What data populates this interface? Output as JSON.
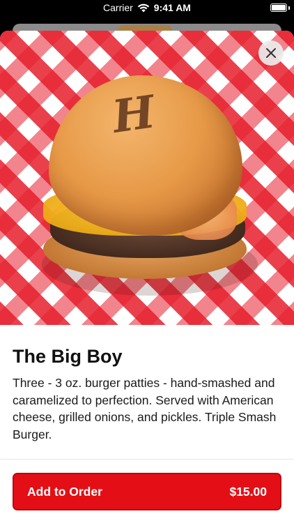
{
  "status_bar": {
    "carrier": "Carrier",
    "time": "9:41 AM",
    "wifi_icon": "wifi-icon",
    "battery_icon": "battery-icon",
    "battery_level": 1.0
  },
  "hero": {
    "image": "burger-photo",
    "bun_brand": "H",
    "close_icon": "close-icon"
  },
  "item": {
    "title": "The Big Boy",
    "description": "Three - 3 oz. burger patties - hand-smashed and caramelized to perfection. Served with American cheese, grilled onions, and pickles. Triple Smash Burger."
  },
  "order_button": {
    "label": "Add to Order",
    "price": "$15.00",
    "color": "#e40f16"
  }
}
